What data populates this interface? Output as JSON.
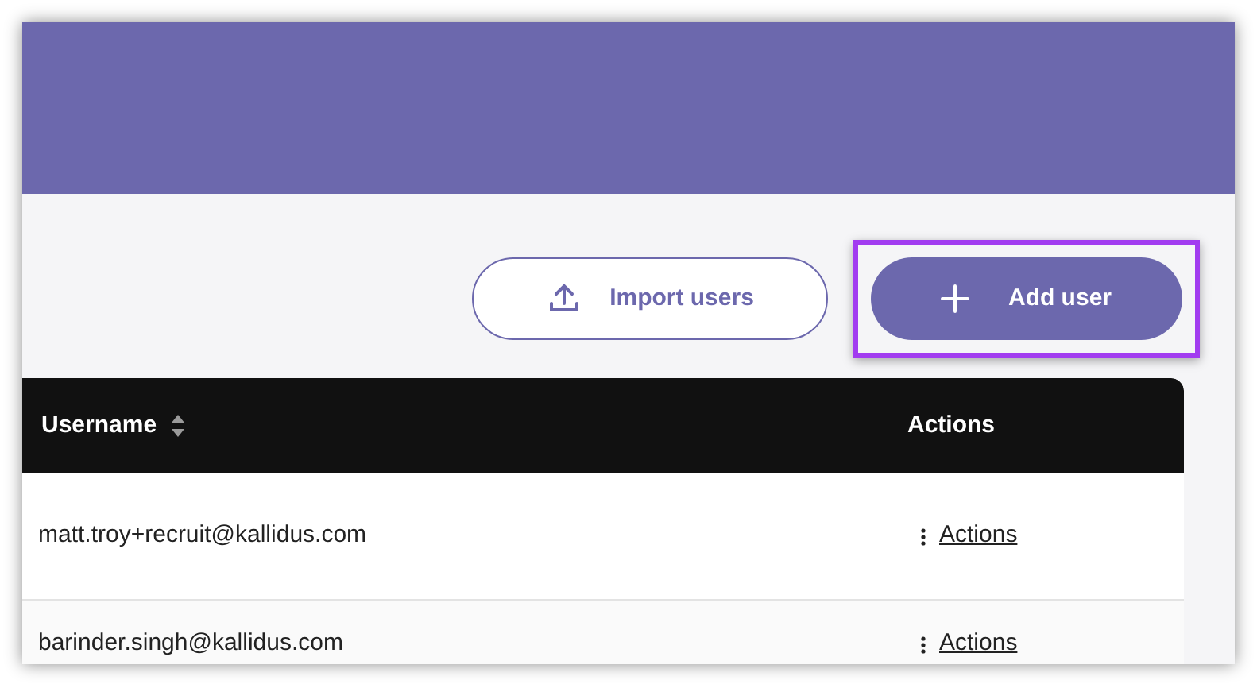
{
  "toolbar": {
    "buttons": [
      {
        "kind": "outline",
        "label": "Import users",
        "highlighted": false
      },
      {
        "kind": "primary",
        "label": "Add user",
        "highlighted": true
      }
    ]
  },
  "table": {
    "columns": [
      {
        "label": "Username",
        "sortable": true
      },
      {
        "label": "Actions",
        "sortable": false
      }
    ],
    "rows": [
      {
        "username": "matt.troy+recruit@kallidus.com",
        "action": "Actions"
      },
      {
        "username": "barinder.singh@kallidus.com",
        "action": "Actions"
      }
    ]
  }
}
